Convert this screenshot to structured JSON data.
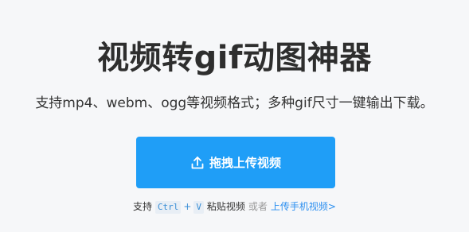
{
  "hero": {
    "title": "视频转gif动图神器",
    "subtitle": "支持mp4、webm、ogg等视频格式；多种gif尺寸一键输出下载。"
  },
  "upload": {
    "button_label": "拖拽上传视频",
    "icon": "upload-icon",
    "color": "#1f9ef7"
  },
  "hint": {
    "prefix": "支持",
    "key_ctrl": "Ctrl",
    "plus": "+",
    "key_v": "V",
    "paste_label": "粘贴视频",
    "or": "或者",
    "mobile_link": "上传手机视频>"
  }
}
